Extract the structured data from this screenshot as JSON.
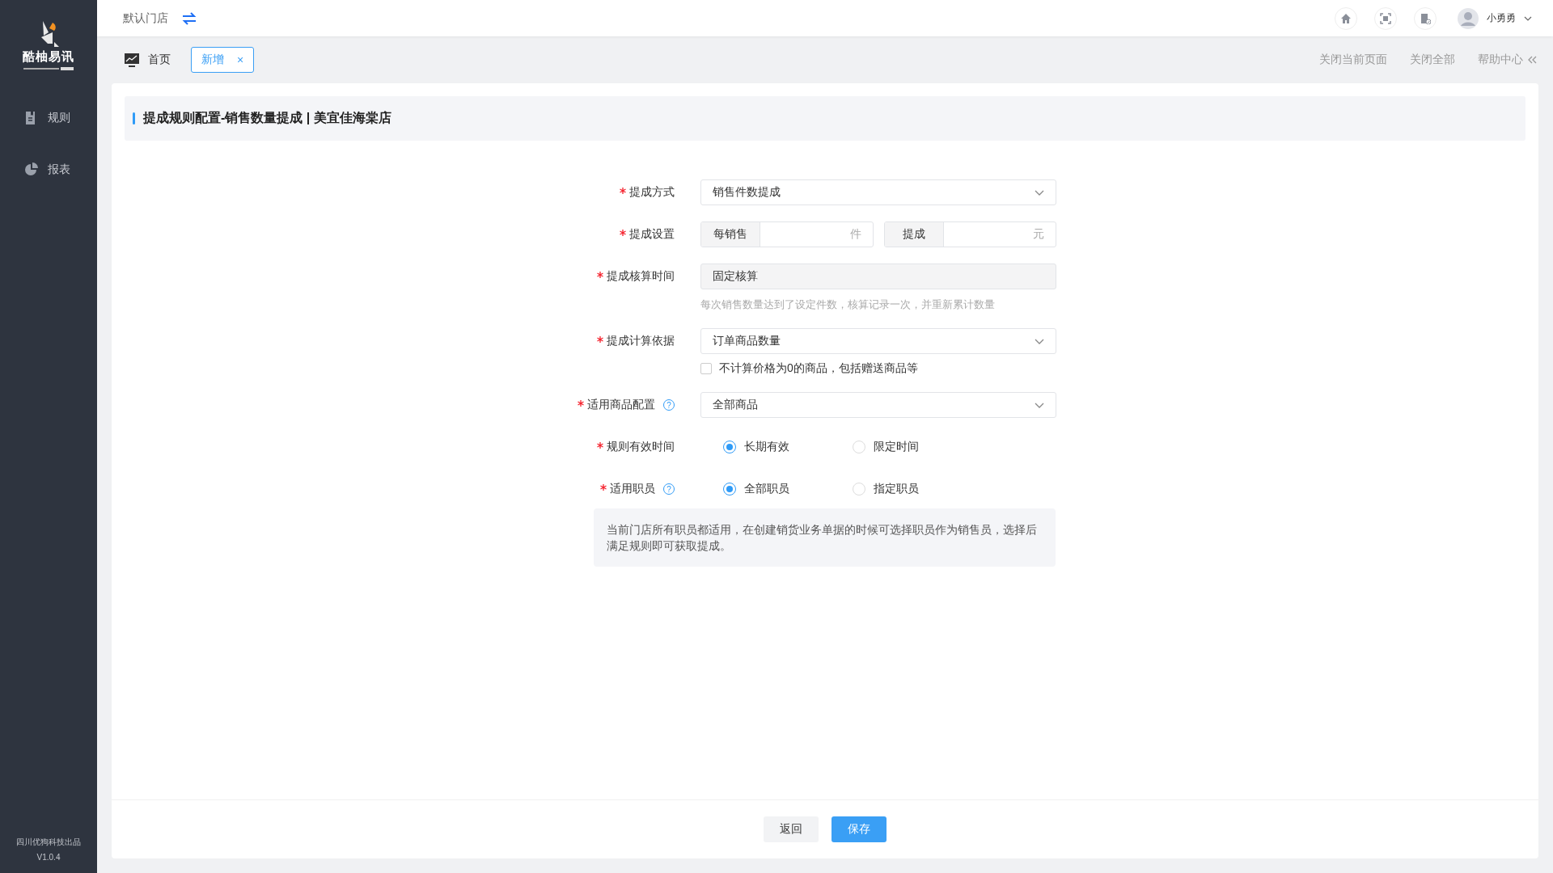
{
  "sidebar": {
    "brand": "酷柚易讯",
    "menu": [
      {
        "label": "规则",
        "selected": false
      },
      {
        "label": "报表",
        "selected": false
      }
    ],
    "footer": [
      "四川优狗科技出品",
      "V1.0.4"
    ]
  },
  "header": {
    "store": "默认门店",
    "user": "小勇勇"
  },
  "tabs": [
    {
      "label": "首页",
      "kind": "home",
      "selected": false
    },
    {
      "label": "新增",
      "kind": "closable",
      "close": "×",
      "selected": true
    }
  ],
  "tab_actions": [
    "关闭当前页面",
    "关闭全部",
    "帮助中心"
  ],
  "page_title": "提成规则配置-销售数量提成 | 美宜佳海棠店",
  "form": [
    {
      "kind": "select",
      "label": "提成方式",
      "required": true,
      "value": "销售件数提成"
    },
    {
      "kind": "pair",
      "label": "提成设置",
      "required": true,
      "parts": [
        {
          "prefix": "每销售",
          "suffix": "件"
        },
        {
          "prefix": "提成",
          "suffix": "元"
        }
      ]
    },
    {
      "kind": "readonly",
      "label": "提成核算时间",
      "required": true,
      "value": "固定核算",
      "hint": "每次销售数量达到了设定件数，核算记录一次，并重新累计数量"
    },
    {
      "kind": "select",
      "label": "提成计算依据",
      "required": true,
      "value": "订单商品数量",
      "checkbox": {
        "label": "不计算价格为0的商品，包括赠送商品等",
        "checked": false
      }
    },
    {
      "kind": "select",
      "label": "适用商品配置",
      "required": true,
      "help": "?",
      "value": "全部商品"
    },
    {
      "kind": "radio",
      "label": "规则有效时间",
      "required": true,
      "options": [
        {
          "label": "长期有效",
          "selected": true
        },
        {
          "label": "限定时间",
          "selected": false
        }
      ]
    },
    {
      "kind": "radio",
      "label": "适用职员",
      "required": true,
      "help": "?",
      "options": [
        {
          "label": "全部职员",
          "selected": true
        },
        {
          "label": "指定职员",
          "selected": false
        }
      ],
      "note": "当前门店所有职员都适用，在创建销货业务单据的时候可选择职员作为销售员，选择后满足规则即可获取提成。"
    }
  ],
  "buttons": [
    {
      "label": "返回",
      "kind": "default"
    },
    {
      "label": "保存",
      "kind": "primary"
    }
  ]
}
